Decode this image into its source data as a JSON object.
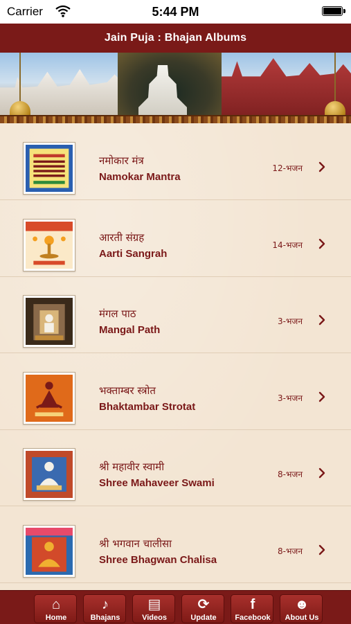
{
  "status": {
    "carrier": "Carrier",
    "time": "5:44 PM"
  },
  "header": {
    "title": "Jain Puja : Bhajan Albums"
  },
  "albums": [
    {
      "title_hi": "नमोकार मंत्र",
      "title_en": "Namokar Mantra",
      "count": "12-भजन",
      "thumb": "namokar-thumbnail"
    },
    {
      "title_hi": "आरती संग्रह",
      "title_en": "Aarti Sangrah",
      "count": "14-भजन",
      "thumb": "aarti-thumbnail"
    },
    {
      "title_hi": "मंगल पाठ",
      "title_en": "Mangal Path",
      "count": "3-भजन",
      "thumb": "mangal-path-thumbnail"
    },
    {
      "title_hi": "भक्ताम्बर स्त्रोत",
      "title_en": "Bhaktambar Strotat",
      "count": "3-भजन",
      "thumb": "bhaktambar-thumbnail"
    },
    {
      "title_hi": "श्री महावीर स्वामी",
      "title_en": "Shree Mahaveer Swami",
      "count": "8-भजन",
      "thumb": "mahaveer-thumbnail"
    },
    {
      "title_hi": "श्री भगवान चालीसा",
      "title_en": "Shree Bhagwan Chalisa",
      "count": "8-भजन",
      "thumb": "chalisa-thumbnail"
    }
  ],
  "tabs": [
    {
      "label": "Home",
      "icon": "home-icon",
      "glyph": "⌂"
    },
    {
      "label": "Bhajans",
      "icon": "music-note-icon",
      "glyph": "♪"
    },
    {
      "label": "Videos",
      "icon": "film-icon",
      "glyph": "▤"
    },
    {
      "label": "Update",
      "icon": "refresh-icon",
      "glyph": "⟳"
    },
    {
      "label": "Facebook",
      "icon": "facebook-icon",
      "glyph": "f"
    },
    {
      "label": "About Us",
      "icon": "people-icon",
      "glyph": "☻"
    }
  ],
  "colors": {
    "primary": "#7a1a18",
    "text": "#7a1818",
    "background": "#f3e5d3"
  }
}
